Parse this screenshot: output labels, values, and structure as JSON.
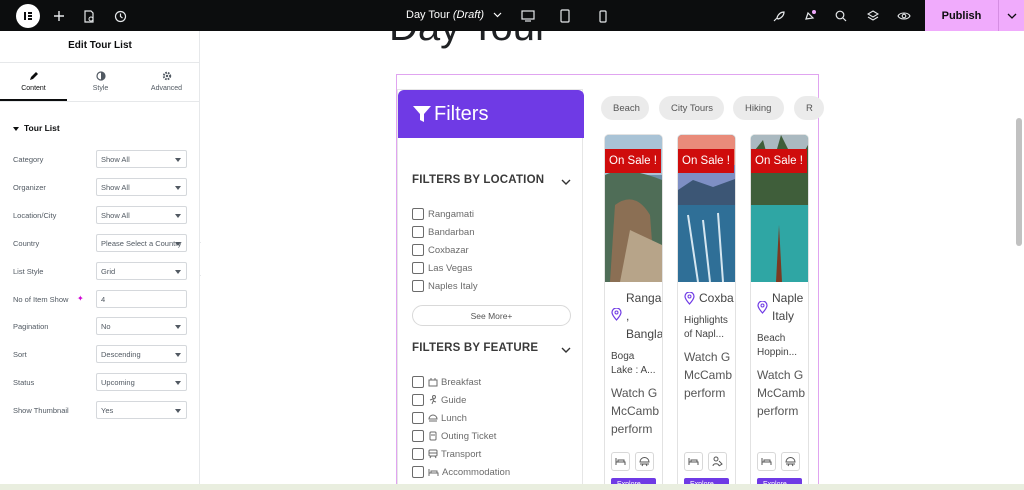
{
  "topbar": {
    "doc_title": "Day Tour",
    "doc_status": "(Draft)",
    "publish_label": "Publish"
  },
  "panel": {
    "title": "Edit Tour List",
    "tabs": [
      {
        "label": "Content"
      },
      {
        "label": "Style"
      },
      {
        "label": "Advanced"
      }
    ],
    "section": "Tour List",
    "controls": [
      {
        "label": "Category",
        "value": "Show All"
      },
      {
        "label": "Organizer",
        "value": "Show All"
      },
      {
        "label": "Location/City",
        "value": "Show All"
      },
      {
        "label": "Country",
        "value": "Please Select a Country"
      },
      {
        "label": "List Style",
        "value": "Grid"
      },
      {
        "label": "No of Item Show",
        "value": "4"
      },
      {
        "label": "Pagination",
        "value": "No"
      },
      {
        "label": "Sort",
        "value": "Descending"
      },
      {
        "label": "Status",
        "value": "Upcoming"
      },
      {
        "label": "Show Thumbnail",
        "value": "Yes"
      }
    ]
  },
  "preview": {
    "page_heading": "Day Tour",
    "filters_title": "Filters",
    "filters_by_location": "FILTERS BY LOCATION",
    "locations": [
      "Rangamati",
      "Bandarban",
      "Coxbazar",
      "Las Vegas",
      "Naples Italy"
    ],
    "see_more": "See More+",
    "filters_by_feature": "FILTERS BY FEATURE",
    "features": [
      "Breakfast",
      "Guide",
      "Lunch",
      "Outing Ticket",
      "Transport",
      "Accommodation"
    ],
    "chips": [
      "Beach",
      "City Tours",
      "Hiking",
      "R"
    ],
    "cards": [
      {
        "sale": "On Sale !",
        "loc1": "Ranga",
        "loc2": ",",
        "loc3": "Bangla",
        "sub1": "Boga",
        "sub2": "Lake : A...",
        "p1": "Watch G",
        "p2": "McCamb",
        "p3": "perform",
        "explore": "Explore"
      },
      {
        "sale": "On Sale !",
        "loc1": "Coxba",
        "sub1": "Highlights",
        "sub2": "of Napl...",
        "p1": "Watch G",
        "p2": "McCamb",
        "p3": "perform",
        "explore": "Explore"
      },
      {
        "sale": "On Sale !",
        "loc1": "Naple",
        "loc2": "Italy",
        "sub1": "Beach",
        "sub2": "Hoppin...",
        "p1": "Watch G",
        "p2": "McCamb",
        "p3": "perform",
        "explore": "Explore"
      }
    ]
  },
  "colors": {
    "accent": "#6f3ae5",
    "sale": "#cf0c0c",
    "publish": "#f0abfc",
    "topbar": "#0c0d0e"
  }
}
